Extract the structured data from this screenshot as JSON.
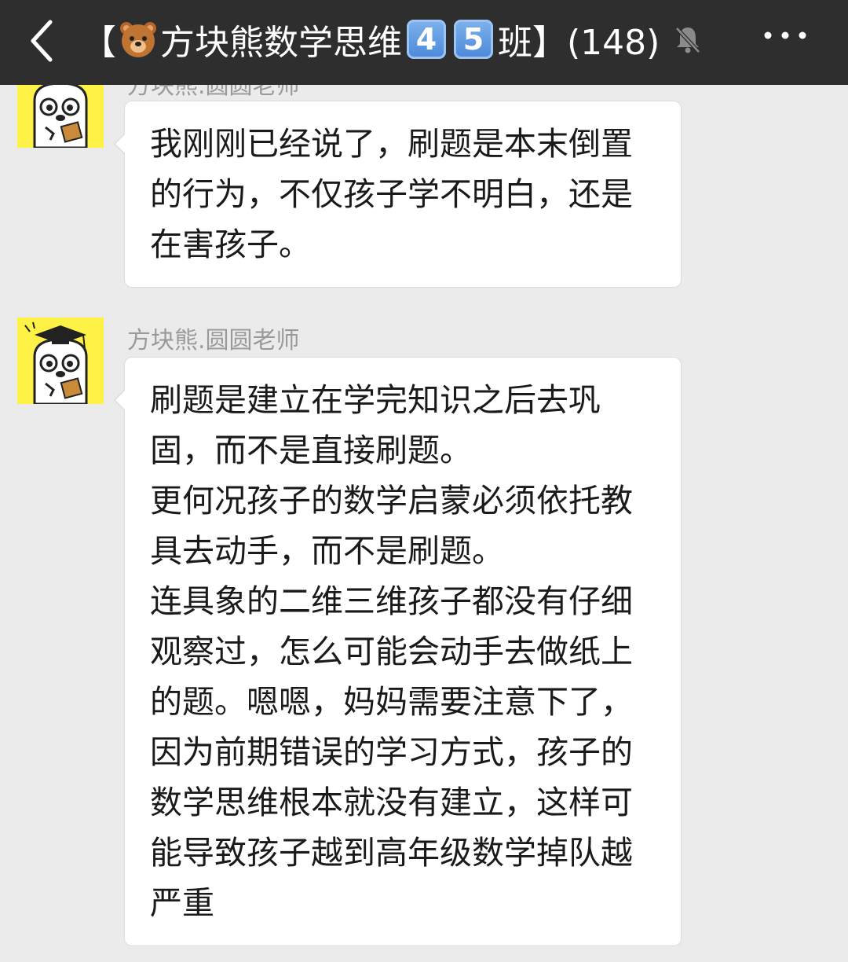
{
  "header": {
    "bracket_open": "【",
    "title_text": "方块熊数学思维",
    "key1": "4",
    "key2": "5",
    "title_suffix": "班】(148)"
  },
  "messages": [
    {
      "sender": "方块熊.圆圆老师",
      "paragraphs": [
        "我刚刚已经说了，刷题是本末倒置的行为，不仅孩子学不明白，还是在害孩子。"
      ]
    },
    {
      "sender": "方块熊.圆圆老师",
      "highlight_line1": "刷题是建立在学完知识之后去巩",
      "highlight_line2": "固，而不是直接刷题。",
      "paragraph2": "更何况孩子的数学启蒙必须依托教具去动手，而不是刷题。",
      "paragraph3": "连具象的二维三维孩子都没有仔细观察过，怎么可能会动手去做纸上的题。嗯嗯，妈妈需要注意下了，因为前期错误的学习方式，孩子的数学思维根本就没有建立，这样可能导致孩子越到高年级数学掉队越严重"
    }
  ],
  "colors": {
    "topbar": "#2e2e2e",
    "background": "#ebebeb",
    "avatar_bg": "#fff246",
    "underline": "#ff3030",
    "keycap": "#4a88d8"
  },
  "icons": [
    "back-icon",
    "bear-emoji-icon",
    "mute-bell-icon",
    "more-icon",
    "teacher-bear-avatar"
  ]
}
